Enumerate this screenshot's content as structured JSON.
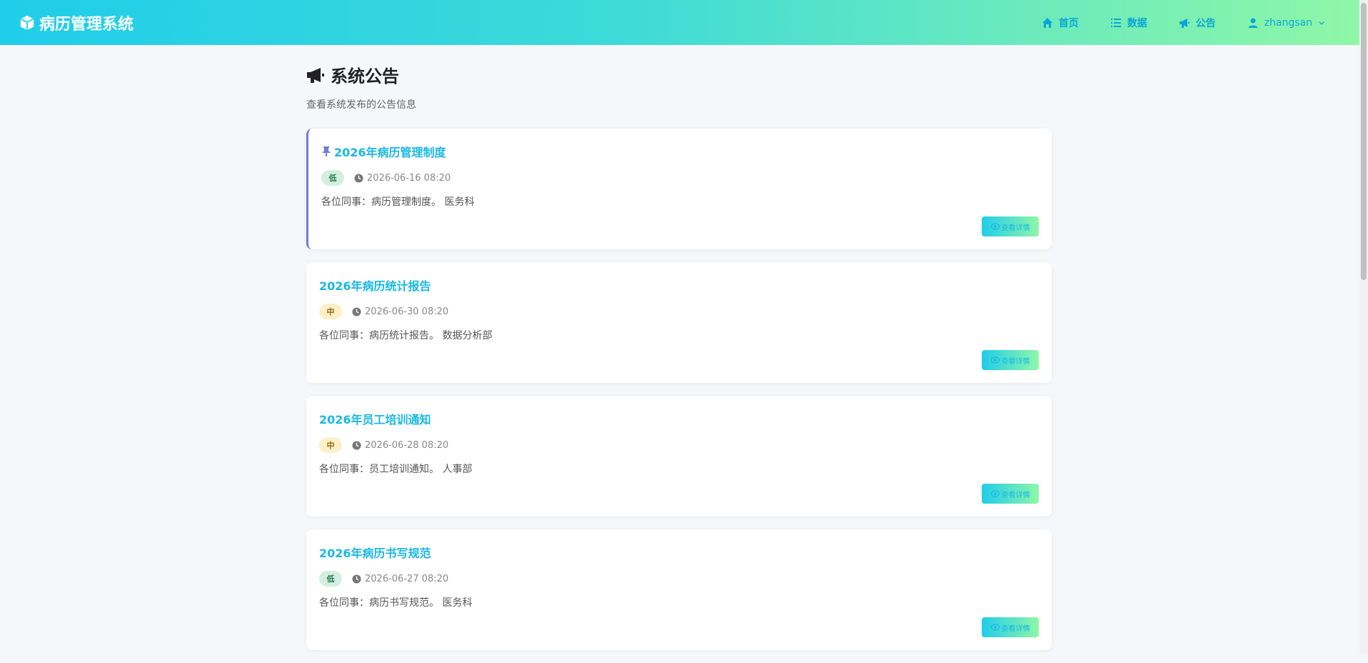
{
  "app": {
    "title": "病历管理系统"
  },
  "nav": {
    "home": "首页",
    "data": "数据",
    "notice": "公告",
    "user": "zhangsan"
  },
  "page": {
    "title": "系统公告",
    "subtitle": "查看系统发布的公告信息"
  },
  "detail_label": "查看详情",
  "colors": {
    "header_gradient_start": "#20cdea",
    "header_gradient_end": "#8ff7a7",
    "link": "#19b8e3",
    "pinned_border": "#6b7fd7"
  },
  "announcements": [
    {
      "title": "2026年病历管理制度",
      "pinned": true,
      "priority": "低",
      "time": "2026-06-16 08:20",
      "content": "各位同事：病历管理制度。 医务科"
    },
    {
      "title": "2026年病历统计报告",
      "pinned": false,
      "priority": "中",
      "time": "2026-06-30 08:20",
      "content": "各位同事：病历统计报告。 数据分析部"
    },
    {
      "title": "2026年员工培训通知",
      "pinned": false,
      "priority": "中",
      "time": "2026-06-28 08:20",
      "content": "各位同事：员工培训通知。 人事部"
    },
    {
      "title": "2026年病历书写规范",
      "pinned": false,
      "priority": "低",
      "time": "2026-06-27 08:20",
      "content": "各位同事：病历书写规范。 医务科"
    }
  ]
}
